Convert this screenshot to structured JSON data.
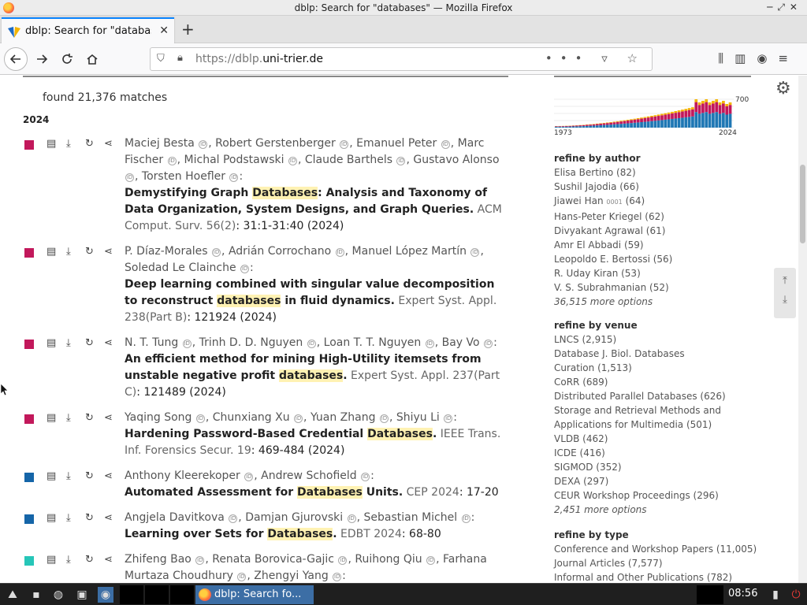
{
  "window": {
    "title": "dblp: Search for \"databases\" — Mozilla Firefox"
  },
  "tab": {
    "title": "dblp: Search for \"databases\"",
    "close": "✕",
    "new_tab": "+"
  },
  "urlbar": {
    "prefix": "https://dblp.",
    "domain": "uni-trier.de"
  },
  "results": {
    "found": "found 21,376 matches",
    "year": "2024",
    "entries": [
      {
        "color": "#c2185b",
        "authors_html": "Maciej Besta, Robert Gerstenberger, Emanuel Peter, Marc Fischer, Michal Podstawski, Claude Barthels, Gustavo Alonso, Torsten Hoefler:",
        "title_pre": "Demystifying Graph ",
        "title_hl": "Databases",
        "title_post": ": Analysis and Taxonomy of Data Organization, System Designs, and Graph Queries.",
        "venue": "ACM Comput. Surv. 56(2)",
        "pages": ": 31:1-31:40 (2024)"
      },
      {
        "color": "#c2185b",
        "title_pre": "Deep learning combined with singular value decomposition to reconstruct ",
        "title_hl": "databases",
        "title_post": " in fluid dynamics.",
        "venue": "Expert Syst. Appl. 238(Part B)",
        "pages": ": 121924 (2024)"
      },
      {
        "color": "#c2185b",
        "title_pre": "An efficient method for mining High-Utility itemsets from unstable negative profit ",
        "title_hl": "databases",
        "title_post": ".",
        "venue": "Expert Syst. Appl. 237(Part C)",
        "pages": ": 121489 (2024)"
      },
      {
        "color": "#c2185b",
        "title_pre": "Hardening Password-Based Credential ",
        "title_hl": "Databases",
        "title_post": ".",
        "venue": "IEEE Trans. Inf. Forensics Secur. 19",
        "pages": ": 469-484 (2024)"
      },
      {
        "color": "#1565a8",
        "title_pre": "Automated Assessment for ",
        "title_hl": "Databases",
        "title_post": " Units.",
        "venue": "CEP 2024",
        "pages": ": 17-20"
      },
      {
        "color": "#1565a8",
        "title_pre": "Learning over Sets for ",
        "title_hl": "Databases",
        "title_post": ".",
        "venue": "EDBT 2024",
        "pages": ": 68-80"
      },
      {
        "color": "#26c6b8"
      }
    ],
    "authors": [
      [
        "Maciej Besta",
        "Robert Gerstenberger",
        "Emanuel Peter",
        "Marc Fischer",
        "Michal Podstawski",
        "Claude Barthels",
        "Gustavo Alonso",
        "Torsten Hoefler"
      ],
      [
        "P. Díaz-Morales",
        "Adrián Corrochano",
        "Manuel López Martín",
        "Soledad Le Clainche"
      ],
      [
        "N. T. Tung",
        "Trinh D. D. Nguyen",
        "Loan T. T. Nguyen",
        "Bay Vo"
      ],
      [
        "Yaqing Song",
        "Chunxiang Xu",
        "Yuan Zhang",
        "Shiyu Li"
      ],
      [
        "Anthony Kleerekoper",
        "Andrew Schofield"
      ],
      [
        "Angjela Davitkova",
        "Damjan Gjurovski",
        "Sebastian Michel"
      ],
      [
        "Zhifeng Bao",
        "Renata Borovica-Gajic",
        "Ruihong Qiu",
        "Farhana Murtaza Choudhury",
        "Zhengyi Yang"
      ]
    ]
  },
  "histogram": {
    "start_year": "1973",
    "end_year": "2024",
    "max_label": "700"
  },
  "refine_author": {
    "heading": "refine by author",
    "items": [
      "Elisa Bertino (82)",
      "Sushil Jajodia (66)",
      "Jiawei Han",
      "Hans-Peter Kriegel (62)",
      "Divyakant Agrawal (61)",
      "Amr El Abbadi (59)",
      "Leopoldo E. Bertossi (56)",
      "R. Uday Kiran (53)",
      "V. S. Subrahmanian (52)"
    ],
    "han_suffix": "0001",
    "han_count": "(64)",
    "more": "36,515 more options"
  },
  "refine_venue": {
    "heading": "refine by venue",
    "items": [
      "LNCS (2,915)",
      "Database J. Biol. Databases Curation (1,513)",
      "CoRR (689)",
      "Distributed Parallel Databases (626)",
      "Storage and Retrieval Methods and Applications for Multimedia (501)",
      "VLDB (462)",
      "ICDE (416)",
      "SIGMOD (352)",
      "DEXA (297)",
      "CEUR Workshop Proceedings (296)"
    ],
    "more": "2,451 more options"
  },
  "refine_type": {
    "heading": "refine by type",
    "items": [
      "Conference and Workshop Papers (11,005)",
      "Journal Articles (7,577)",
      "Informal and Other Publications (782)"
    ]
  },
  "taskbar": {
    "task_label": "dblp: Search fo...",
    "clock": "08:56"
  }
}
